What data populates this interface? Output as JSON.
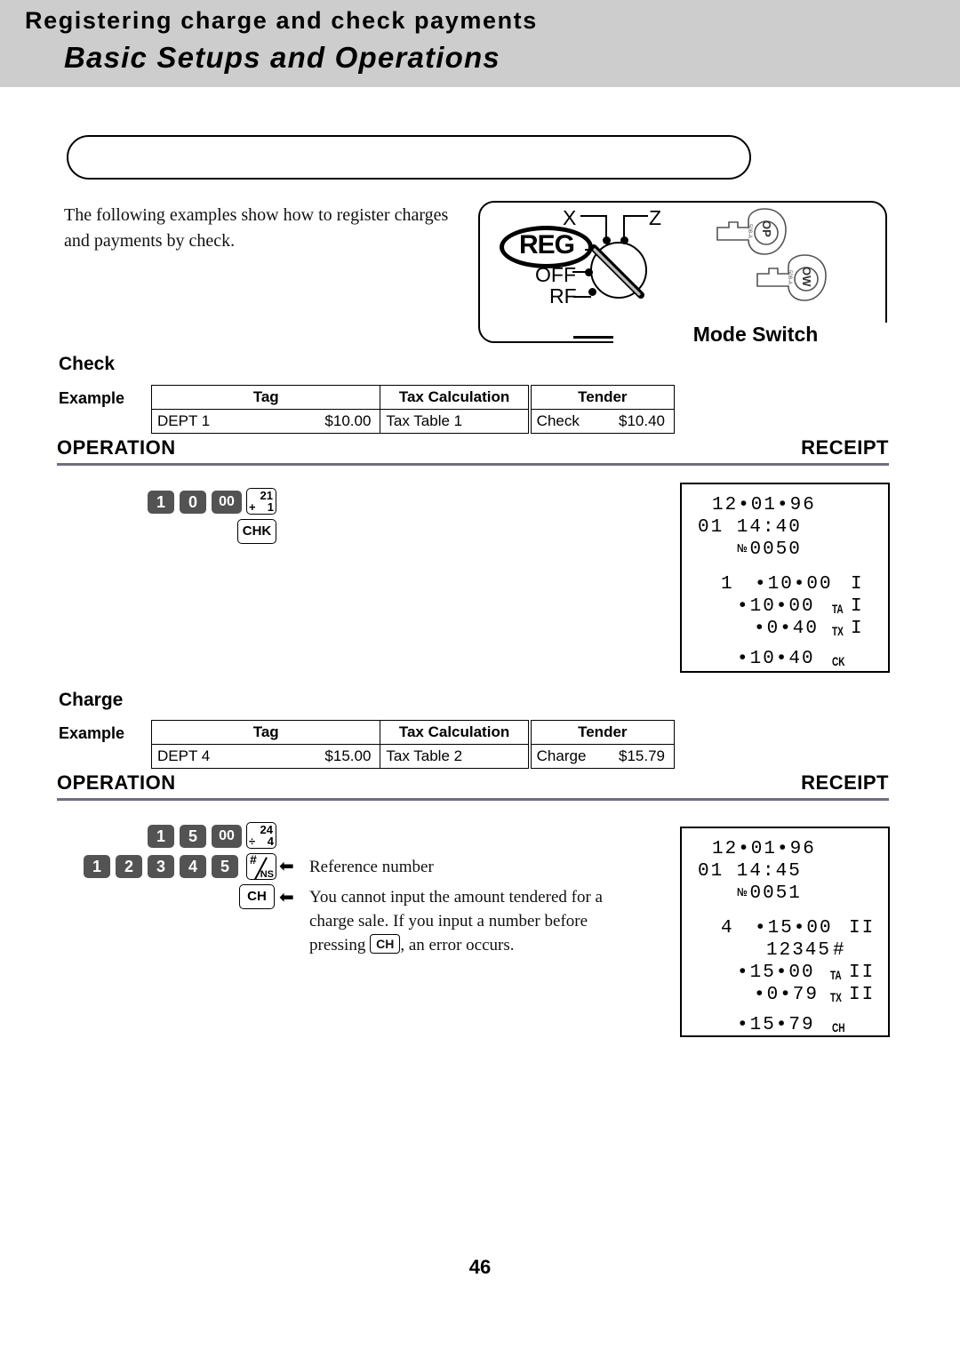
{
  "header": {
    "title": "Basic Setups and Operations"
  },
  "section": {
    "title": "Registering charge and check payments",
    "intro": "The following examples show how to register charges and payments by check."
  },
  "mode_switch": {
    "caption": "Mode Switch",
    "positions": [
      "X",
      "Z",
      "REG",
      "OFF",
      "RF"
    ],
    "selected": "REG",
    "keys": [
      "OP",
      "OW"
    ]
  },
  "check": {
    "heading": "Check",
    "example_label": "Example",
    "table": {
      "headers": [
        "Tag",
        "Tax Calculation",
        "Tender"
      ],
      "row": {
        "tag_name": "DEPT 1",
        "tag_amount": "$10.00",
        "tax_calculation": "Tax Table 1",
        "tender_name": "Check",
        "tender_amount": "$10.40"
      }
    },
    "operation_label": "OPERATION",
    "receipt_label": "RECEIPT",
    "keys_row1": [
      "1",
      "0",
      "00"
    ],
    "dept_key": {
      "top": "21",
      "left": "+",
      "bottom": "1"
    },
    "tender_key": "CHK",
    "receipt_lines": [
      {
        "text": "12•01•96"
      },
      {
        "text": "01 14:40"
      },
      {
        "no": "№",
        "text": "0050"
      },
      {
        "qty": "1",
        "text": "•10•00",
        "suffix": "",
        "dept": "I"
      },
      {
        "text": "•10•00",
        "suffix": "TA",
        "dept": "I"
      },
      {
        "text": "•0•40",
        "suffix": "TX",
        "dept": "I"
      },
      {
        "text": "•10•40",
        "suffix": "CK",
        "dept": ""
      }
    ]
  },
  "charge": {
    "heading": "Charge",
    "example_label": "Example",
    "table": {
      "headers": [
        "Tag",
        "Tax Calculation",
        "Tender"
      ],
      "row": {
        "tag_name": "DEPT 4",
        "tag_amount": "$15.00",
        "tax_calculation": "Tax Table 2",
        "tender_name": "Charge",
        "tender_amount": "$15.79"
      }
    },
    "operation_label": "OPERATION",
    "receipt_label": "RECEIPT",
    "keys_row1": [
      "1",
      "5",
      "00"
    ],
    "dept_key": {
      "top": "24",
      "left": "÷",
      "bottom": "4"
    },
    "keys_row2": [
      "1",
      "2",
      "3",
      "4",
      "5"
    ],
    "ns_key": {
      "hash": "#",
      "ns": "NS"
    },
    "tender_key": "CH",
    "note1": "Reference number",
    "note2_part1": "You cannot input the amount tendered for a charge sale.  If you input a number before pressing",
    "note2_key": "CH",
    "note2_part2": ", an error occurs.",
    "receipt_lines": [
      {
        "text": "12•01•96"
      },
      {
        "text": "01 14:45"
      },
      {
        "no": "№",
        "text": "0051"
      },
      {
        "qty": "4",
        "text": "•15•00",
        "suffix": "",
        "dept": "II"
      },
      {
        "text": "12345",
        "suffix": "#",
        "dept": ""
      },
      {
        "text": "•15•00",
        "suffix": "TA",
        "dept": "II"
      },
      {
        "text": "•0•79",
        "suffix": "TX",
        "dept": "II"
      },
      {
        "text": "•15•79",
        "suffix": "CH",
        "dept": ""
      }
    ]
  },
  "page": {
    "number": "46"
  }
}
